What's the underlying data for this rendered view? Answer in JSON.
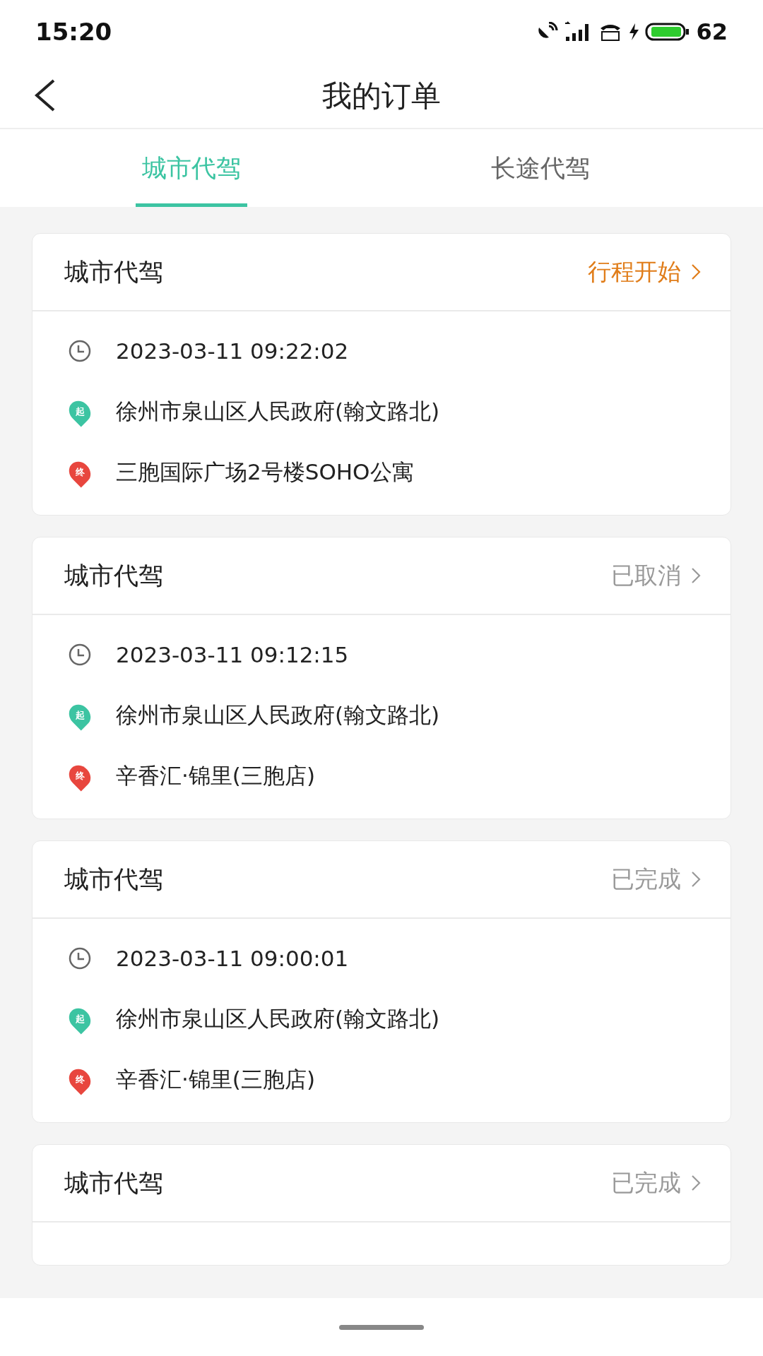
{
  "status_bar": {
    "time": "15:20",
    "battery": "62"
  },
  "header": {
    "title": "我的订单"
  },
  "tabs": [
    {
      "label": "城市代驾",
      "selected": true
    },
    {
      "label": "长途代驾",
      "selected": false
    }
  ],
  "orders": [
    {
      "title": "城市代驾",
      "status": "行程开始",
      "highlighted": true,
      "time": "2023-03-11 09:22:02",
      "start_mark": "起",
      "start": "徐州市泉山区人民政府(翰文路北)",
      "end_mark": "终",
      "end": "三胞国际广场2号楼SOHO公寓"
    },
    {
      "title": "城市代驾",
      "status": "已取消",
      "highlighted": false,
      "time": "2023-03-11 09:12:15",
      "start_mark": "起",
      "start": "徐州市泉山区人民政府(翰文路北)",
      "end_mark": "终",
      "end": "辛香汇·锦里(三胞店)"
    },
    {
      "title": "城市代驾",
      "status": "已完成",
      "highlighted": false,
      "time": "2023-03-11 09:00:01",
      "start_mark": "起",
      "start": "徐州市泉山区人民政府(翰文路北)",
      "end_mark": "终",
      "end": "辛香汇·锦里(三胞店)"
    },
    {
      "title": "城市代驾",
      "status": "已完成",
      "highlighted": false
    }
  ]
}
